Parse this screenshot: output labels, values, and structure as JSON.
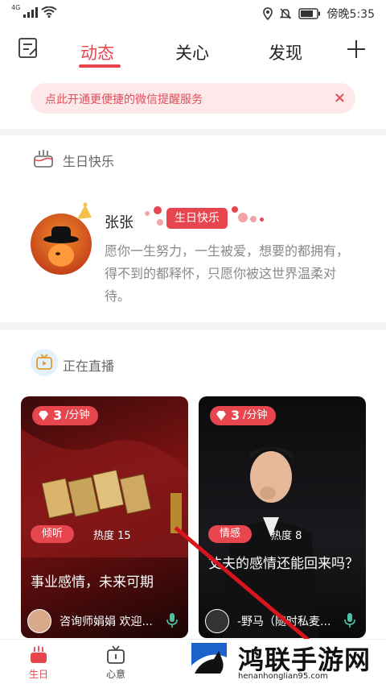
{
  "status_bar": {
    "network": "4G",
    "time": "傍晚5:35"
  },
  "nav": {
    "tabs": [
      {
        "label": "动态",
        "active": true
      },
      {
        "label": "关心",
        "active": false
      },
      {
        "label": "发现",
        "active": false
      }
    ]
  },
  "banner": {
    "text": "点此开通更便捷的微信提醒服务",
    "close": "×"
  },
  "birthday_section": {
    "title": "生日快乐",
    "name": "张张",
    "badge": "生日快乐",
    "wish": "愿你一生努力，一生被爱，想要的都拥有，得不到的都释怀，只愿你被这世界温柔对待。"
  },
  "live_section": {
    "title": "正在直播",
    "cards": [
      {
        "price_num": "3",
        "price_unit": "/分钟",
        "tag": "倾听",
        "heat": "热度 15",
        "title": "事业感情，未来可期",
        "host": "咨询师娟娟 欢迎..."
      },
      {
        "price_num": "3",
        "price_unit": "/分钟",
        "tag": "情感",
        "heat": "热度 8",
        "title": "丈夫的感情还能回来吗？",
        "host": "-野马（随时私麦..."
      }
    ]
  },
  "tabbar": {
    "items": [
      {
        "label": "生日",
        "active": true
      },
      {
        "label": "心意",
        "active": false
      }
    ]
  },
  "watermark": {
    "title": "鸿联手游网",
    "url": "henanhonglian95.com"
  },
  "colors": {
    "accent": "#e8464f",
    "banner_bg": "#fde8ea"
  }
}
